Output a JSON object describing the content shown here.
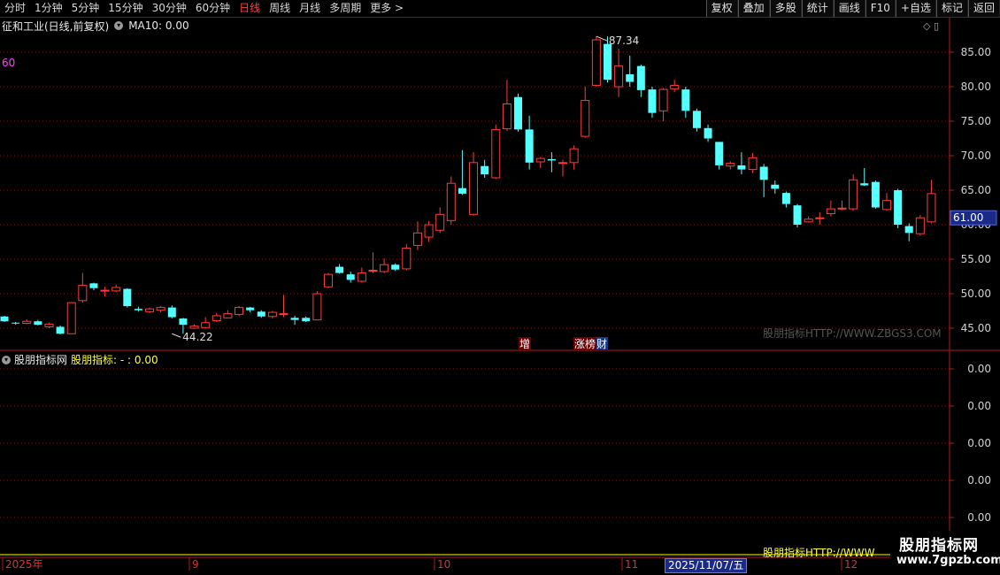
{
  "toolbar": {
    "periods": [
      {
        "label": "分时",
        "active": false
      },
      {
        "label": "1分钟",
        "active": false
      },
      {
        "label": "5分钟",
        "active": false
      },
      {
        "label": "15分钟",
        "active": false
      },
      {
        "label": "30分钟",
        "active": false
      },
      {
        "label": "60分钟",
        "active": false
      },
      {
        "label": "日线",
        "active": true
      },
      {
        "label": "周线",
        "active": false
      },
      {
        "label": "月线",
        "active": false
      },
      {
        "label": "多周期",
        "active": false
      },
      {
        "label": "更多 >",
        "active": false
      }
    ],
    "right_buttons": [
      "复权",
      "叠加",
      "多股",
      "统计",
      "画线",
      "F10",
      "+自选",
      "标记",
      "返回"
    ]
  },
  "chart_title": {
    "stock": "征和工业(日线,前复权)",
    "ma_label": "MA10: 0.00"
  },
  "period_marker": "60",
  "price_axis": {
    "ticks": [
      "85.00",
      "80.00",
      "75.00",
      "70.00",
      "65.00",
      "60.00",
      "55.00",
      "50.00",
      "45.00"
    ],
    "current_price": "61.00"
  },
  "annotations": {
    "high": "87.34",
    "low": "44.22",
    "tag_zeng": "增",
    "tag_zhangbang": "涨榜",
    "tag_cai": "财",
    "watermark": "股朋指标HTTP://WWW.ZBGS3.COM"
  },
  "indicator": {
    "name": "股朋指标网",
    "label": "股朋指标: - : 0.00",
    "ticks": [
      "0.00",
      "0.00",
      "0.00",
      "0.00",
      "0.00"
    ]
  },
  "time_axis": {
    "labels": [
      "2025年",
      "9",
      "10",
      "11",
      "12"
    ],
    "selected_date": "2025/11/07/五"
  },
  "bottom_link": "股朋指标HTTP://WWW",
  "brand": {
    "line1": "股朋指标网",
    "line2": "www.7gpzb.com"
  },
  "colors": {
    "up": "#ff3b3b",
    "down": "#54ffff",
    "grid": "#8b1010",
    "axis": "#b01818",
    "indicator_line": "#ffff00"
  },
  "chart_data": {
    "type": "candlestick",
    "ylim": [
      42,
      88
    ],
    "candles": [
      [
        46.7,
        46.0,
        46.8,
        45.9
      ],
      [
        45.8,
        45.7,
        45.9,
        45.5
      ],
      [
        45.7,
        46.0,
        46.3,
        45.6
      ],
      [
        46.0,
        45.5,
        46.2,
        45.4
      ],
      [
        45.2,
        45.6,
        45.8,
        45.0
      ],
      [
        45.2,
        44.2,
        45.4,
        44.1
      ],
      [
        44.2,
        48.7,
        48.8,
        44.2
      ],
      [
        49.0,
        51.2,
        53.0,
        48.7
      ],
      [
        51.5,
        50.8,
        51.6,
        50.5
      ],
      [
        50.5,
        50.5,
        51.0,
        49.6
      ],
      [
        50.4,
        50.9,
        51.3,
        50.2
      ],
      [
        50.7,
        48.2,
        50.8,
        48.0
      ],
      [
        47.8,
        47.6,
        48.1,
        47.4
      ],
      [
        47.4,
        47.8,
        48.0,
        47.2
      ],
      [
        47.6,
        48.0,
        48.2,
        47.3
      ],
      [
        48.0,
        46.6,
        48.3,
        46.4
      ],
      [
        46.4,
        45.5,
        46.5,
        44.2
      ],
      [
        45.0,
        45.3,
        45.6,
        44.9
      ],
      [
        45.1,
        45.8,
        46.6,
        45.0
      ],
      [
        46.1,
        46.8,
        47.2,
        45.9
      ],
      [
        46.5,
        47.1,
        47.6,
        46.4
      ],
      [
        47.0,
        48.0,
        48.2,
        46.8
      ],
      [
        48.0,
        47.6,
        48.1,
        47.3
      ],
      [
        47.4,
        46.7,
        47.6,
        46.5
      ],
      [
        46.7,
        47.3,
        47.5,
        46.4
      ],
      [
        47.1,
        47.1,
        49.8,
        46.6
      ],
      [
        46.5,
        46.2,
        46.8,
        45.5
      ],
      [
        46.5,
        46.0,
        46.7,
        45.9
      ],
      [
        46.2,
        50.0,
        50.4,
        46.2
      ],
      [
        51.0,
        52.8,
        53.0,
        50.8
      ],
      [
        53.9,
        53.0,
        54.3,
        52.9
      ],
      [
        52.8,
        52.0,
        53.2,
        51.6
      ],
      [
        51.8,
        53.0,
        53.8,
        51.6
      ],
      [
        53.4,
        53.4,
        56.0,
        53.0
      ],
      [
        53.2,
        54.2,
        55.1,
        53.0
      ],
      [
        54.2,
        53.5,
        54.4,
        53.3
      ],
      [
        53.6,
        56.6,
        57.2,
        53.4
      ],
      [
        57.0,
        58.8,
        60.5,
        56.3
      ],
      [
        58.2,
        60.0,
        60.5,
        57.5
      ],
      [
        59.2,
        61.5,
        62.5,
        58.8
      ],
      [
        60.6,
        66.0,
        67.0,
        60.0
      ],
      [
        65.3,
        64.5,
        70.8,
        64.3
      ],
      [
        61.5,
        69.0,
        70.5,
        61.3
      ],
      [
        68.5,
        67.3,
        69.4,
        66.8
      ],
      [
        66.8,
        73.8,
        74.5,
        66.6
      ],
      [
        73.9,
        77.5,
        81.0,
        73.6
      ],
      [
        78.5,
        73.8,
        79.0,
        73.5
      ],
      [
        73.8,
        69.0,
        75.8,
        68.0
      ],
      [
        69.1,
        69.6,
        69.8,
        68.2
      ],
      [
        69.5,
        69.3,
        70.5,
        67.6
      ],
      [
        69.0,
        69.0,
        69.4,
        67.0
      ],
      [
        69.0,
        71.0,
        71.5,
        68.0
      ],
      [
        72.8,
        78.0,
        80.0,
        72.6
      ],
      [
        80.2,
        86.8,
        87.3,
        80.0
      ],
      [
        86.2,
        81.0,
        87.3,
        80.6
      ],
      [
        80.0,
        83.0,
        85.5,
        78.5
      ],
      [
        81.8,
        80.7,
        84.5,
        80.0
      ],
      [
        83.0,
        79.5,
        83.2,
        78.5
      ],
      [
        79.6,
        76.2,
        80.0,
        75.5
      ],
      [
        76.5,
        79.6,
        79.8,
        75.0
      ],
      [
        79.7,
        80.2,
        81.0,
        79.2
      ],
      [
        79.6,
        76.5,
        80.0,
        75.5
      ],
      [
        76.5,
        74.0,
        76.8,
        73.5
      ],
      [
        74.0,
        72.5,
        74.5,
        72.0
      ],
      [
        72.0,
        68.6,
        72.0,
        68.0
      ],
      [
        68.5,
        68.9,
        69.2,
        68.0
      ],
      [
        68.6,
        68.0,
        70.5,
        67.3
      ],
      [
        68.0,
        69.7,
        70.4,
        67.5
      ],
      [
        68.4,
        66.5,
        68.8,
        64.0
      ],
      [
        65.8,
        65.2,
        66.4,
        64.5
      ],
      [
        64.6,
        63.0,
        64.8,
        62.5
      ],
      [
        62.8,
        60.0,
        63.0,
        59.6
      ],
      [
        60.4,
        60.8,
        61.2,
        60.3
      ],
      [
        61.0,
        61.0,
        61.8,
        60.0
      ],
      [
        61.6,
        62.3,
        63.5,
        61.2
      ],
      [
        62.3,
        62.4,
        63.5,
        62.1
      ],
      [
        62.3,
        66.5,
        67.3,
        62.0
      ],
      [
        66.0,
        65.7,
        68.2,
        65.6
      ],
      [
        66.2,
        62.5,
        66.4,
        62.3
      ],
      [
        62.2,
        63.5,
        64.6,
        62.0
      ],
      [
        65.0,
        60.0,
        65.2,
        59.5
      ],
      [
        59.8,
        58.8,
        60.2,
        57.6
      ],
      [
        58.7,
        61.0,
        61.4,
        58.4
      ],
      [
        60.4,
        64.5,
        66.5,
        60.2
      ]
    ]
  }
}
